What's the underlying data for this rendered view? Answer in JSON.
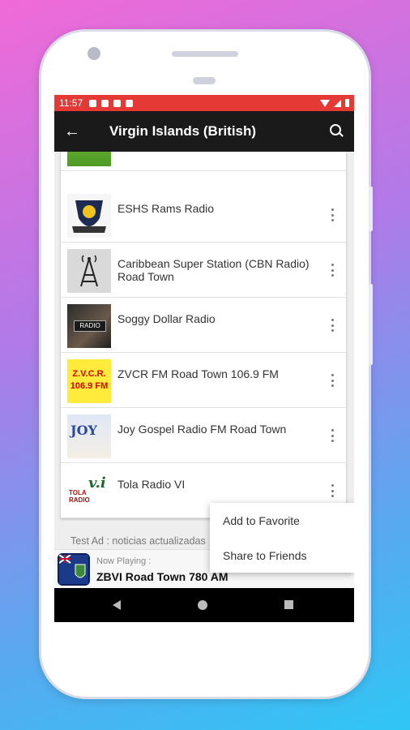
{
  "status_bar": {
    "time": "11:57"
  },
  "app_bar": {
    "title": "Virgin Islands (British)",
    "back_icon": "arrow-back-icon",
    "search_icon": "search-icon"
  },
  "stations": [
    {
      "name": ""
    },
    {
      "name": "ESHS Rams Radio"
    },
    {
      "name": "Caribbean Super Station (CBN Radio) Road Town"
    },
    {
      "name": "Soggy Dollar Radio"
    },
    {
      "name": "ZVCR FM Road Town 106.9 FM"
    },
    {
      "name": "Joy Gospel Radio FM Road Town"
    },
    {
      "name": "Tola Radio VI"
    }
  ],
  "thumb_text": {
    "zvcr_top": "Z.V.C.R.",
    "zvcr_bottom": "106.9 FM",
    "joy": "JOY",
    "tola": "v.i",
    "tola_sub": "TOLA RADIO",
    "soggy": "RADIO"
  },
  "ad_text": "Test Ad : noticias actualizadas",
  "now_playing": {
    "label": "Now Playing :",
    "station": "ZBVI Road Town 780 AM"
  },
  "context_menu": {
    "items": [
      "Add to Favorite",
      "Share to Friends"
    ]
  },
  "colors": {
    "status_bar": "#e53935",
    "app_bar": "#1a1a1a",
    "background_start": "#f06ad8",
    "background_end": "#2fc6f4"
  }
}
